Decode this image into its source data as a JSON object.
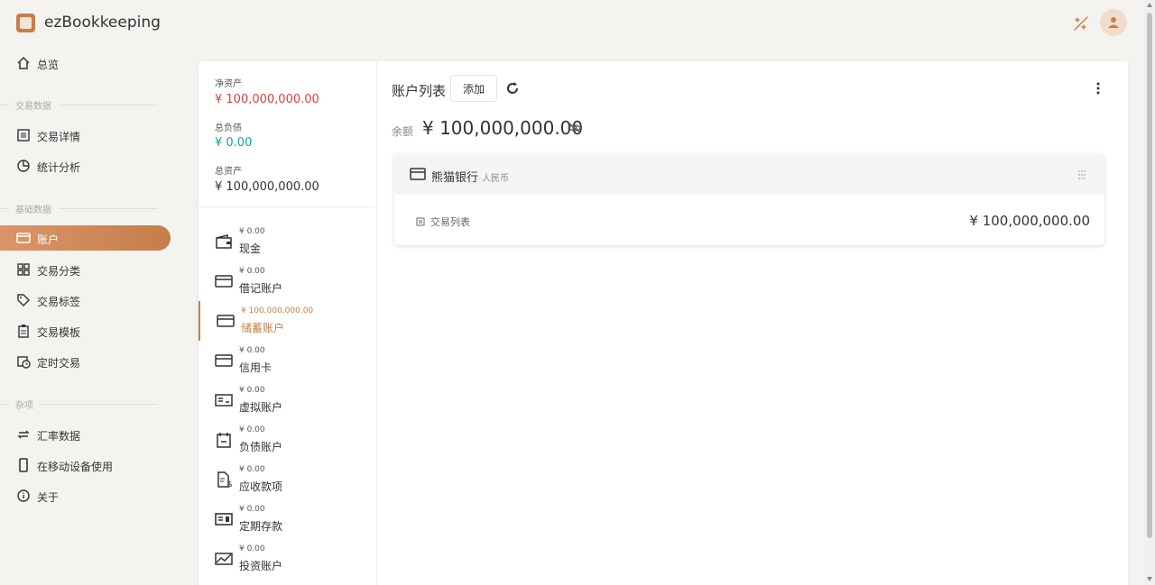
{
  "app": {
    "title": "ezBookkeeping"
  },
  "colors": {
    "accent": "#c67e48",
    "negative": "#e03c3c",
    "positive": "#13a594"
  },
  "sidebar": {
    "overview": "总览",
    "sections": [
      {
        "title": "交易数据",
        "items": [
          "交易详情",
          "统计分析"
        ]
      },
      {
        "title": "基础数据",
        "items": [
          "账户",
          "交易分类",
          "交易标签",
          "交易模板",
          "定时交易"
        ]
      },
      {
        "title": "杂项",
        "items": [
          "汇率数据",
          "在移动设备使用",
          "关于"
        ]
      }
    ],
    "icons": {
      "overview": "home-icon",
      "tx_detail": "list-icon",
      "stats": "pie-chart-icon",
      "accounts": "credit-card-icon",
      "categories": "grid-icon",
      "tags": "tag-icon",
      "templates": "clipboard-icon",
      "scheduled": "calendar-clock-icon",
      "exchange": "exchange-icon",
      "mobile": "phone-icon",
      "about": "info-icon"
    }
  },
  "summary": {
    "net_assets_label": "净资产",
    "net_assets_value": "¥ 100,000,000.00",
    "liabilities_label": "总负债",
    "liabilities_value": "¥ 0.00",
    "total_assets_label": "总资产",
    "total_assets_value": "¥ 100,000,000.00"
  },
  "account_categories": [
    {
      "name": "现金",
      "value": "¥ 0.00",
      "icon": "wallet-icon"
    },
    {
      "name": "借记账户",
      "value": "¥ 0.00",
      "icon": "debit-card-icon"
    },
    {
      "name": "储蓄账户",
      "value": "¥ 100,000,000.00",
      "icon": "savings-card-icon",
      "selected": true
    },
    {
      "name": "信用卡",
      "value": "¥ 0.00",
      "icon": "credit-card-icon"
    },
    {
      "name": "虚拟账户",
      "value": "¥ 0.00",
      "icon": "virtual-account-icon"
    },
    {
      "name": "负债账户",
      "value": "¥ 0.00",
      "icon": "debt-icon"
    },
    {
      "name": "应收款项",
      "value": "¥ 0.00",
      "icon": "receivable-icon"
    },
    {
      "name": "定期存款",
      "value": "¥ 0.00",
      "icon": "deposit-icon"
    },
    {
      "name": "投资账户",
      "value": "¥ 0.00",
      "icon": "investment-icon"
    }
  ],
  "main": {
    "list_title": "账户列表",
    "add_label": "添加",
    "balance_label": "余额",
    "balance_value": "¥ 100,000,000.00",
    "account": {
      "name": "熊猫银行",
      "currency": "人民币",
      "tx_link": "交易列表",
      "balance": "¥ 100,000,000.00"
    }
  }
}
